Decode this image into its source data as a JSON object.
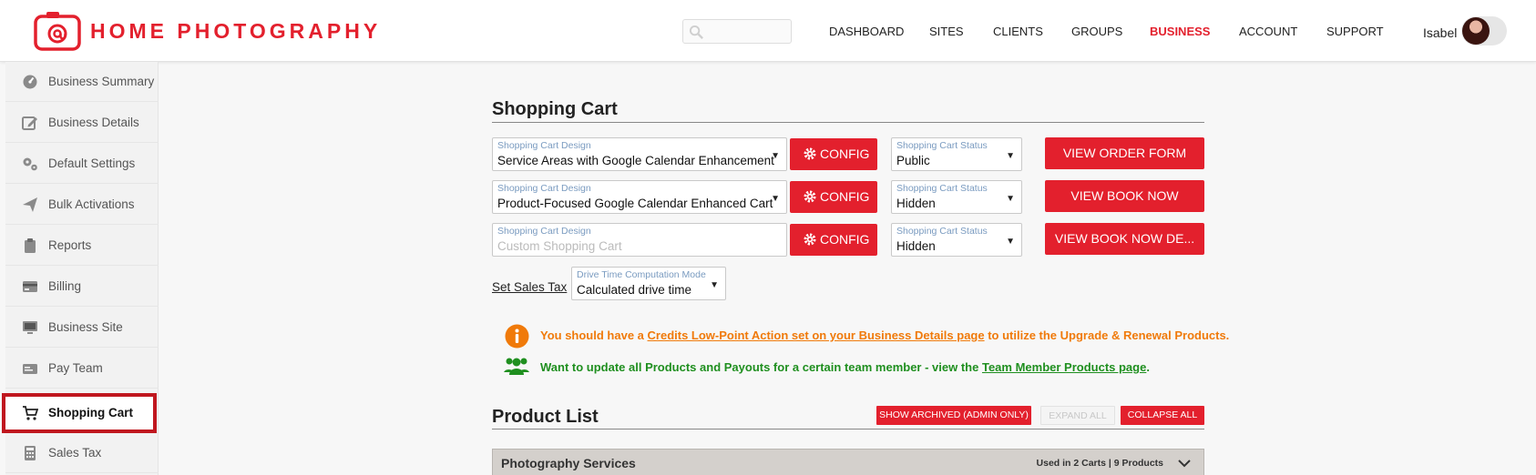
{
  "brand": {
    "name": "HOME PHOTOGRAPHY",
    "color": "#e3202d"
  },
  "header": {
    "search": {
      "placeholder": "",
      "icon": "search-icon"
    },
    "nav": [
      {
        "label": "DASHBOARD",
        "active": false
      },
      {
        "label": "SITES",
        "active": false
      },
      {
        "label": "CLIENTS",
        "active": false
      },
      {
        "label": "GROUPS",
        "active": false
      },
      {
        "label": "BUSINESS",
        "active": true
      },
      {
        "label": "ACCOUNT",
        "active": false
      },
      {
        "label": "SUPPORT",
        "active": false
      }
    ],
    "user": {
      "name": "Isabel"
    }
  },
  "sidebar": {
    "items": [
      {
        "label": "Business Summary",
        "icon": "gauge-icon"
      },
      {
        "label": "Business Details",
        "icon": "edit-icon"
      },
      {
        "label": "Default Settings",
        "icon": "gears-icon"
      },
      {
        "label": "Bulk Activations",
        "icon": "paper-plane-icon"
      },
      {
        "label": "Reports",
        "icon": "clipboard-icon"
      },
      {
        "label": "Billing",
        "icon": "credit-card-icon"
      },
      {
        "label": "Business Site",
        "icon": "monitor-icon"
      },
      {
        "label": "Pay Team",
        "icon": "payment-card-icon"
      },
      {
        "label": "Shopping Cart",
        "icon": "cart-icon",
        "active": true
      },
      {
        "label": "Sales Tax",
        "icon": "calculator-icon"
      }
    ]
  },
  "shopping_cart": {
    "title": "Shopping Cart",
    "rows": [
      {
        "design_caption": "Shopping Cart Design",
        "design_value": "Service Areas with Google Calendar Enhancement",
        "config_label": "CONFIG",
        "status_caption": "Shopping Cart Status",
        "status_value": "Public",
        "action_label": "VIEW ORDER FORM"
      },
      {
        "design_caption": "Shopping Cart Design",
        "design_value": "Product-Focused Google Calendar Enhanced Cart",
        "config_label": "CONFIG",
        "status_caption": "Shopping Cart Status",
        "status_value": "Hidden",
        "action_label": "VIEW BOOK NOW"
      },
      {
        "design_caption": "Shopping Cart Design",
        "design_value": "Custom Shopping Cart",
        "design_is_placeholder": true,
        "config_label": "CONFIG",
        "status_caption": "Shopping Cart Status",
        "status_value": "Hidden",
        "action_label": "VIEW BOOK NOW DE..."
      }
    ],
    "sales_tax_link": "Set Sales Tax",
    "drive_time": {
      "caption": "Drive Time Computation Mode",
      "value": "Calculated drive time"
    },
    "notices": [
      {
        "icon": "info-circle-icon",
        "color": "#f07a0a",
        "before": "You should have a ",
        "link": "Credits Low-Point Action set on your Business Details page",
        "after": " to utilize the Upgrade & Renewal Products."
      },
      {
        "icon": "users-icon",
        "color": "#1f8f1f",
        "before": "Want to update all Products and Payouts for a certain team member - view the ",
        "link": "Team Member Products page",
        "after": "."
      }
    ]
  },
  "product_list": {
    "title": "Product List",
    "buttons": {
      "show_archived": "SHOW ARCHIVED (ADMIN ONLY)",
      "expand_all": "EXPAND ALL",
      "collapse_all": "COLLAPSE ALL"
    },
    "groups": [
      {
        "name": "Photography Services",
        "meta": "Used in 2 Carts | 9 Products"
      }
    ]
  }
}
